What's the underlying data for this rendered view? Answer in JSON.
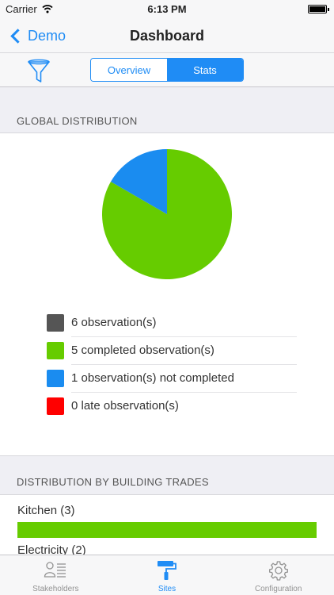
{
  "status_bar": {
    "carrier": "Carrier",
    "time": "6:13 PM"
  },
  "nav": {
    "back_label": "Demo",
    "title": "Dashboard"
  },
  "toolbar": {
    "segments": [
      {
        "label": "Overview",
        "selected": false
      },
      {
        "label": "Stats",
        "selected": true
      }
    ]
  },
  "global": {
    "header": "GLOBAL DISTRIBUTION",
    "legend": [
      {
        "label": "6 observation(s)",
        "color": "#555555"
      },
      {
        "label": "5 completed observation(s)",
        "color": "#66cc00"
      },
      {
        "label": "1 observation(s) not completed",
        "color": "#1a8cf0"
      },
      {
        "label": "0 late observation(s)",
        "color": "#ff0000"
      }
    ]
  },
  "chart_data": {
    "type": "pie",
    "slices": [
      {
        "label": "5 completed observation(s)",
        "value": 5,
        "color": "#66cc00"
      },
      {
        "label": "1 observation(s) not completed",
        "value": 1,
        "color": "#1a8cf0"
      },
      {
        "label": "0 late observation(s)",
        "value": 0,
        "color": "#ff0000"
      }
    ],
    "total_label": "6 observation(s)",
    "total": 6
  },
  "trades": {
    "header": "DISTRIBUTION BY BUILDING TRADES",
    "items": [
      {
        "label": "Kitchen (3)",
        "completed_fraction": 1.0,
        "color": "#66cc00"
      },
      {
        "label": "Electricity (2)",
        "completed_fraction": 1.0,
        "color": "#66cc00"
      }
    ]
  },
  "tabs": [
    {
      "label": "Stakeholders",
      "icon": "stakeholders-icon",
      "active": false
    },
    {
      "label": "Sites",
      "icon": "paint-roller-icon",
      "active": true
    },
    {
      "label": "Configuration",
      "icon": "gear-icon",
      "active": false
    }
  ]
}
